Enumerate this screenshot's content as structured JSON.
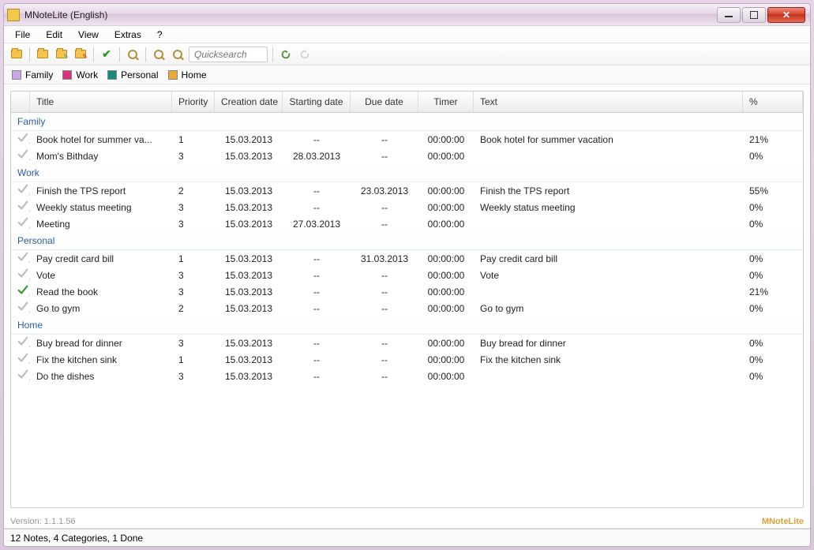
{
  "window": {
    "title": "MNoteLite (English)"
  },
  "menubar": {
    "items": [
      "File",
      "Edit",
      "View",
      "Extras",
      "?"
    ]
  },
  "toolbar": {
    "search_placeholder": "Quicksearch"
  },
  "categories": [
    {
      "name": "Family",
      "color": "#c9a8e9"
    },
    {
      "name": "Work",
      "color": "#d6337e"
    },
    {
      "name": "Personal",
      "color": "#1a8a7d"
    },
    {
      "name": "Home",
      "color": "#e9a83a"
    }
  ],
  "columns": {
    "icon": "",
    "title": "Title",
    "priority": "Priority",
    "created": "Creation date",
    "start": "Starting date",
    "due": "Due date",
    "timer": "Timer",
    "text": "Text",
    "pct": "%"
  },
  "groups": [
    {
      "name": "Family",
      "rows": [
        {
          "done": false,
          "title": "Book hotel for summer va...",
          "priority": "1",
          "created": "15.03.2013",
          "start": "--",
          "due": "--",
          "timer": "00:00:00",
          "text": "Book hotel for summer vacation",
          "pct": "21%"
        },
        {
          "done": false,
          "title": "Mom's Bithday",
          "priority": "3",
          "created": "15.03.2013",
          "start": "28.03.2013",
          "due": "--",
          "timer": "00:00:00",
          "text": "",
          "pct": "0%"
        }
      ]
    },
    {
      "name": "Work",
      "rows": [
        {
          "done": false,
          "title": "Finish the TPS report",
          "priority": "2",
          "created": "15.03.2013",
          "start": "--",
          "due": "23.03.2013",
          "timer": "00:00:00",
          "text": "Finish the TPS report",
          "pct": "55%"
        },
        {
          "done": false,
          "title": "Weekly status meeting",
          "priority": "3",
          "created": "15.03.2013",
          "start": "--",
          "due": "--",
          "timer": "00:00:00",
          "text": "Weekly status meeting",
          "pct": "0%"
        },
        {
          "done": false,
          "title": "Meeting",
          "priority": "3",
          "created": "15.03.2013",
          "start": "27.03.2013",
          "due": "--",
          "timer": "00:00:00",
          "text": "",
          "pct": "0%"
        }
      ]
    },
    {
      "name": "Personal",
      "rows": [
        {
          "done": false,
          "title": "Pay credit card bill",
          "priority": "1",
          "created": "15.03.2013",
          "start": "--",
          "due": "31.03.2013",
          "timer": "00:00:00",
          "text": "Pay credit card bill",
          "pct": "0%"
        },
        {
          "done": false,
          "title": "Vote",
          "priority": "3",
          "created": "15.03.2013",
          "start": "--",
          "due": "--",
          "timer": "00:00:00",
          "text": "Vote",
          "pct": "0%"
        },
        {
          "done": true,
          "title": "Read the book",
          "priority": "3",
          "created": "15.03.2013",
          "start": "--",
          "due": "--",
          "timer": "00:00:00",
          "text": "",
          "pct": "21%"
        },
        {
          "done": false,
          "title": "Go to gym",
          "priority": "2",
          "created": "15.03.2013",
          "start": "--",
          "due": "--",
          "timer": "00:00:00",
          "text": "Go to gym",
          "pct": "0%"
        }
      ]
    },
    {
      "name": "Home",
      "rows": [
        {
          "done": false,
          "title": "Buy bread for dinner",
          "priority": "3",
          "created": "15.03.2013",
          "start": "--",
          "due": "--",
          "timer": "00:00:00",
          "text": "Buy bread for dinner",
          "pct": "0%"
        },
        {
          "done": false,
          "title": "Fix the kitchen sink",
          "priority": "1",
          "created": "15.03.2013",
          "start": "--",
          "due": "--",
          "timer": "00:00:00",
          "text": "Fix the kitchen sink",
          "pct": "0%"
        },
        {
          "done": false,
          "title": "Do the dishes",
          "priority": "3",
          "created": "15.03.2013",
          "start": "--",
          "due": "--",
          "timer": "00:00:00",
          "text": "",
          "pct": "0%"
        }
      ]
    }
  ],
  "version_label": "Version: 1.1.1.56",
  "brand": "MNoteLite",
  "status": "12 Notes, 4 Categories, 1 Done"
}
